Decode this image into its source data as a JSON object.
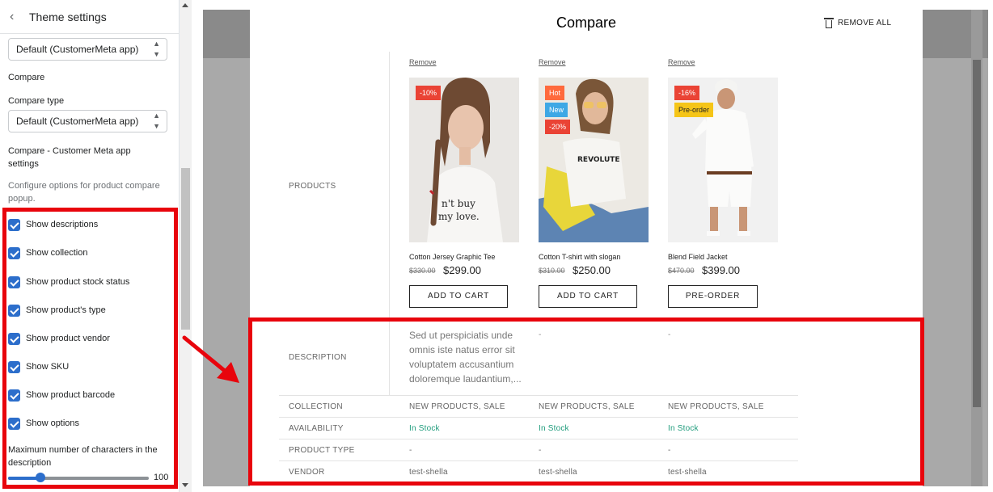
{
  "sidebar": {
    "back_glyph": "‹",
    "title": "Theme settings",
    "top_select": "Default (CustomerMeta app)",
    "compare_heading": "Compare",
    "compare_type_label": "Compare type",
    "compare_type_select": "Default (CustomerMeta app)",
    "app_settings_heading": "Compare - Customer Meta app settings",
    "app_settings_help": "Configure options for product compare popup.",
    "checkboxes": [
      {
        "label": "Show descriptions",
        "checked": true
      },
      {
        "label": "Show collection",
        "checked": true
      },
      {
        "label": "Show product stock status",
        "checked": true
      },
      {
        "label": "Show product's type",
        "checked": true
      },
      {
        "label": "Show product vendor",
        "checked": true
      },
      {
        "label": "Show SKU",
        "checked": true
      },
      {
        "label": "Show product barcode",
        "checked": true
      },
      {
        "label": "Show options",
        "checked": true
      }
    ],
    "max_chars_label": "Maximum number of characters in the description",
    "max_chars_value": "100"
  },
  "compare": {
    "title": "Compare",
    "remove_all": "REMOVE ALL",
    "row_labels": {
      "products": "PRODUCTS",
      "description": "DESCRIPTION",
      "collection": "COLLECTION",
      "availability": "AVAILABILITY",
      "product_type": "PRODUCT TYPE",
      "vendor": "VENDOR"
    },
    "products": [
      {
        "remove": "Remove",
        "badges": [
          {
            "text": "-10%",
            "color": "#ea4335"
          }
        ],
        "name": "Cotton Jersey Graphic Tee",
        "old_price": "$330.00",
        "price": "$299.00",
        "button": "ADD TO CART",
        "description": "Sed ut perspiciatis unde omnis iste natus error sit voluptatem accusantium doloremque laudantium,...",
        "collection": "NEW PRODUCTS, SALE",
        "availability": "In Stock",
        "product_type": "-",
        "vendor": "test-shella"
      },
      {
        "remove": "Remove",
        "badges": [
          {
            "text": "Hot",
            "color": "#ff6a3d"
          },
          {
            "text": "New",
            "color": "#3ea8e5"
          },
          {
            "text": "-20%",
            "color": "#ea4335"
          }
        ],
        "name": "Cotton T-shirt with slogan",
        "old_price": "$310.00",
        "price": "$250.00",
        "button": "ADD TO CART",
        "description": "-",
        "collection": "NEW PRODUCTS, SALE",
        "availability": "In Stock",
        "product_type": "-",
        "vendor": "test-shella"
      },
      {
        "remove": "Remove",
        "badges": [
          {
            "text": "-16%",
            "color": "#ea4335"
          },
          {
            "text": "Pre-order",
            "color": "#f5c518"
          }
        ],
        "name": "Blend Field Jacket",
        "old_price": "$470.00",
        "price": "$399.00",
        "button": "PRE-ORDER",
        "description": "-",
        "collection": "NEW PRODUCTS, SALE",
        "availability": "In Stock",
        "product_type": "-",
        "vendor": "test-shella"
      }
    ]
  },
  "colors": {
    "accent": "#2c6ecb",
    "annotation_red": "#e8040c",
    "in_stock": "#1f9c7c"
  }
}
